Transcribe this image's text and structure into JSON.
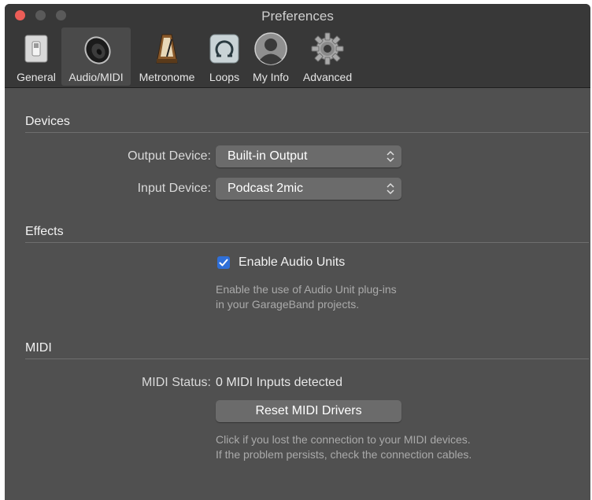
{
  "window": {
    "title": "Preferences"
  },
  "toolbar": {
    "items": [
      {
        "label": "General",
        "icon": "switch-icon"
      },
      {
        "label": "Audio/MIDI",
        "icon": "speaker-icon"
      },
      {
        "label": "Metronome",
        "icon": "metronome-icon"
      },
      {
        "label": "Loops",
        "icon": "loop-icon"
      },
      {
        "label": "My Info",
        "icon": "user-icon"
      },
      {
        "label": "Advanced",
        "icon": "gear-icon"
      }
    ],
    "selected": "Audio/MIDI"
  },
  "devices": {
    "title": "Devices",
    "output_label": "Output Device:",
    "output_value": "Built-in Output",
    "input_label": "Input Device:",
    "input_value": "Podcast 2mic"
  },
  "effects": {
    "title": "Effects",
    "checkbox_label": "Enable Audio Units",
    "checkbox_checked": true,
    "help_line1": "Enable the use of Audio Unit plug-ins",
    "help_line2": "in your GarageBand projects."
  },
  "midi": {
    "title": "MIDI",
    "status_label": "MIDI Status:",
    "status_value": "0 MIDI Inputs detected",
    "reset_label": "Reset MIDI Drivers",
    "help_line1": "Click if you lost the connection to your MIDI devices.",
    "help_line2": "If the problem persists, check the connection cables."
  },
  "colors": {
    "background": "#505050",
    "titlebar": "#383838",
    "accent": "#2f6fd8",
    "close": "#ec5d57"
  }
}
